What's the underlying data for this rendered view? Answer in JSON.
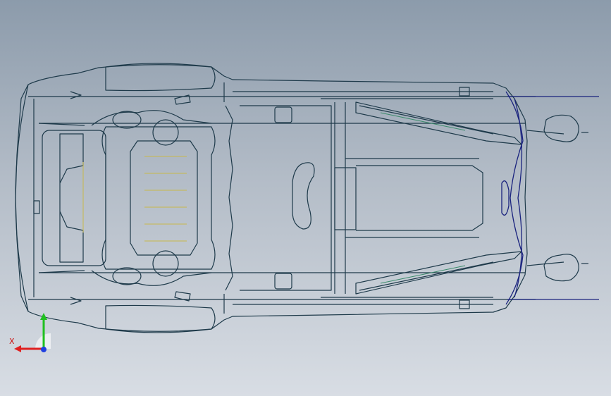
{
  "viewport": {
    "background_top": "#8c9bab",
    "background_bottom": "#d8dde4",
    "line_color": "#1e3a4a",
    "accent_line_color": "#1a237e",
    "highlight_color": "#c8b84a",
    "view": "top"
  },
  "triad": {
    "x_label": "X",
    "x_color": "#e02020",
    "y_color": "#20c020",
    "z_color": "#2040e0"
  }
}
